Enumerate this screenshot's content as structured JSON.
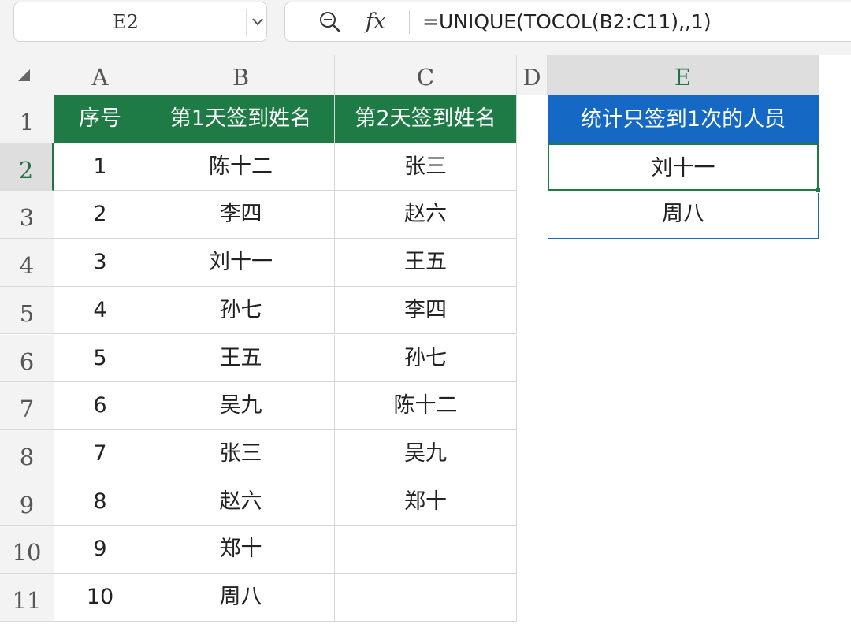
{
  "formula_bar": {
    "name_box": "E2",
    "formula": "=UNIQUE(TOCOL(B2:C11),,1)",
    "fx_label": "fx",
    "icons": [
      "zoom-out-icon",
      "chevron-down-icon",
      "fx-icon"
    ]
  },
  "columns": [
    "A",
    "B",
    "C",
    "D",
    "E"
  ],
  "rows": [
    "1",
    "2",
    "3",
    "4",
    "5",
    "6",
    "7",
    "8",
    "9",
    "10",
    "11"
  ],
  "headers": {
    "A": "序号",
    "B": "第1天签到姓名",
    "C": "第2天签到姓名",
    "E": "统计只签到1次的人员"
  },
  "table": [
    {
      "a": "1",
      "b": "陈十二",
      "c": "张三"
    },
    {
      "a": "2",
      "b": "李四",
      "c": "赵六"
    },
    {
      "a": "3",
      "b": "刘十一",
      "c": "王五"
    },
    {
      "a": "4",
      "b": "孙七",
      "c": "李四"
    },
    {
      "a": "5",
      "b": "王五",
      "c": "孙七"
    },
    {
      "a": "6",
      "b": "吴九",
      "c": "陈十二"
    },
    {
      "a": "7",
      "b": "张三",
      "c": "吴九"
    },
    {
      "a": "8",
      "b": "赵六",
      "c": "郑十"
    },
    {
      "a": "9",
      "b": "郑十",
      "c": ""
    },
    {
      "a": "10",
      "b": "周八",
      "c": ""
    }
  ],
  "result": [
    "刘十一",
    "周八"
  ],
  "selected_cell": "E2",
  "colors": {
    "table_header": "#1e7b45",
    "result_header": "#1568c4",
    "selection": "#1e7b45"
  }
}
